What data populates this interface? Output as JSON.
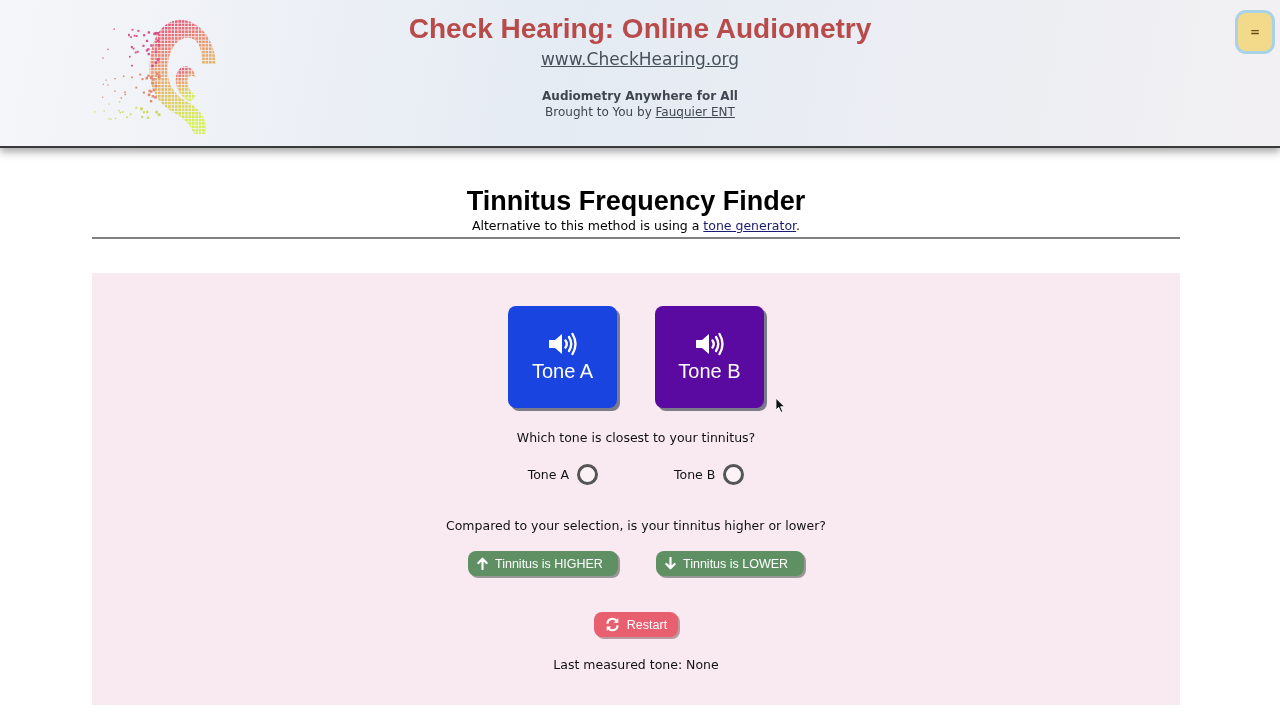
{
  "header": {
    "title": "Check Hearing: Online Audiometry",
    "url": "www.CheckHearing.org",
    "tagline": "Audiometry Anywhere for All",
    "credit": {
      "text": "Brought to You by",
      "link": "Fauquier ENT"
    },
    "menu_button": {
      "label": "="
    }
  },
  "page": {
    "heading": "Tinnitus Frequency Finder",
    "intro": {
      "text": "Alternative to this method is using a",
      "link": "tone generator",
      "after": "."
    }
  },
  "tone_buttons": [
    {
      "label": "Tone A",
      "color": "#1a44e0"
    },
    {
      "label": "Tone B",
      "color": "#5a0aa0"
    }
  ],
  "question": "Which tone is closest to your tinnitus?",
  "choices": [
    {
      "label": "Tone A",
      "selected": false
    },
    {
      "label": "Tone B",
      "selected": false
    }
  ],
  "question_2": "Compared to your selection, is your tinnitus higher or lower?",
  "direction_buttons": [
    {
      "label": "Tinnitus is HIGHER",
      "kind": "up"
    },
    {
      "label": "Tinnitus is LOWER",
      "kind": "down"
    }
  ],
  "restart_button": {
    "label": "Restart"
  },
  "result": "Last measured tone: None"
}
